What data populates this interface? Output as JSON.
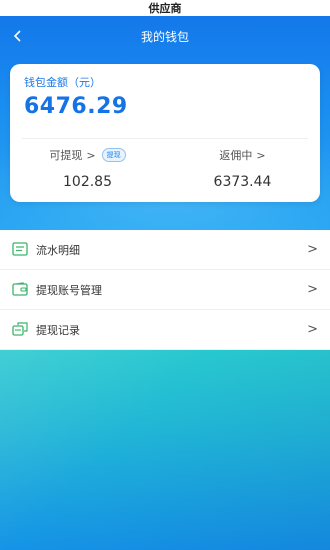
{
  "status_bar": {
    "title": "供应商"
  },
  "nav": {
    "title": "我的钱包"
  },
  "wallet": {
    "label": "钱包金额（元）",
    "amount": "6476.29",
    "withdrawable": {
      "title": "可提现",
      "tag": "提现",
      "value": "102.85"
    },
    "commission": {
      "title": "返佣中",
      "value": "6373.44"
    }
  },
  "menu": [
    {
      "icon": "ledger-icon",
      "label": "流水明细"
    },
    {
      "icon": "wallet-account-icon",
      "label": "提现账号管理"
    },
    {
      "icon": "withdraw-record-icon",
      "label": "提现记录"
    }
  ],
  "colors": {
    "accent": "#1573e6",
    "icon_green": "#3bb36a"
  }
}
